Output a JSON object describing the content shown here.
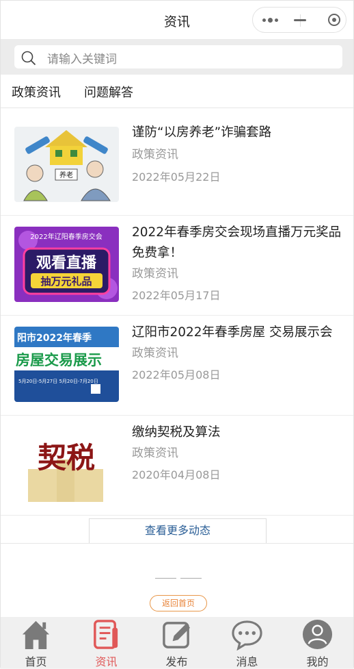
{
  "titlebar": {
    "title": "资讯"
  },
  "search": {
    "placeholder": "请输入关键词"
  },
  "tabs": [
    {
      "label": "政策资讯"
    },
    {
      "label": "问题解答"
    }
  ],
  "news": [
    {
      "title": "谨防“以房养老”诈骗套路",
      "category": "政策资讯",
      "date": "2022年05月22日",
      "thumb_text": "养老"
    },
    {
      "title": "2022年春季房交会现场直播万元奖品免费拿！",
      "category": "政策资讯",
      "date": "2022年05月17日",
      "thumb_text": [
        "2022年辽阳春季房交会",
        "观看直播",
        "抽万元礼品"
      ]
    },
    {
      "title": "辽阳市2022年春季房屋 交易展示会",
      "category": "政策资讯",
      "date": "2022年05月08日",
      "thumb_text": [
        "阳市2022年春季",
        "房屋交易展示",
        "5月20日-5月27日 5月20日-7月20日"
      ]
    },
    {
      "title": "缴纳契税及算法",
      "category": "政策资讯",
      "date": "2020年04月08日",
      "thumb_text": "契税"
    }
  ],
  "more_button": "查看更多动态",
  "home_button": "返回首页",
  "tabbar": [
    {
      "label": "首页",
      "icon": "home-icon"
    },
    {
      "label": "资讯",
      "icon": "document-icon",
      "active": true
    },
    {
      "label": "发布",
      "icon": "edit-icon"
    },
    {
      "label": "消息",
      "icon": "chat-icon"
    },
    {
      "label": "我的",
      "icon": "user-icon"
    }
  ],
  "colors": {
    "accent": "#e05858",
    "link": "#2a5e96",
    "home_button": "#e8843a"
  }
}
